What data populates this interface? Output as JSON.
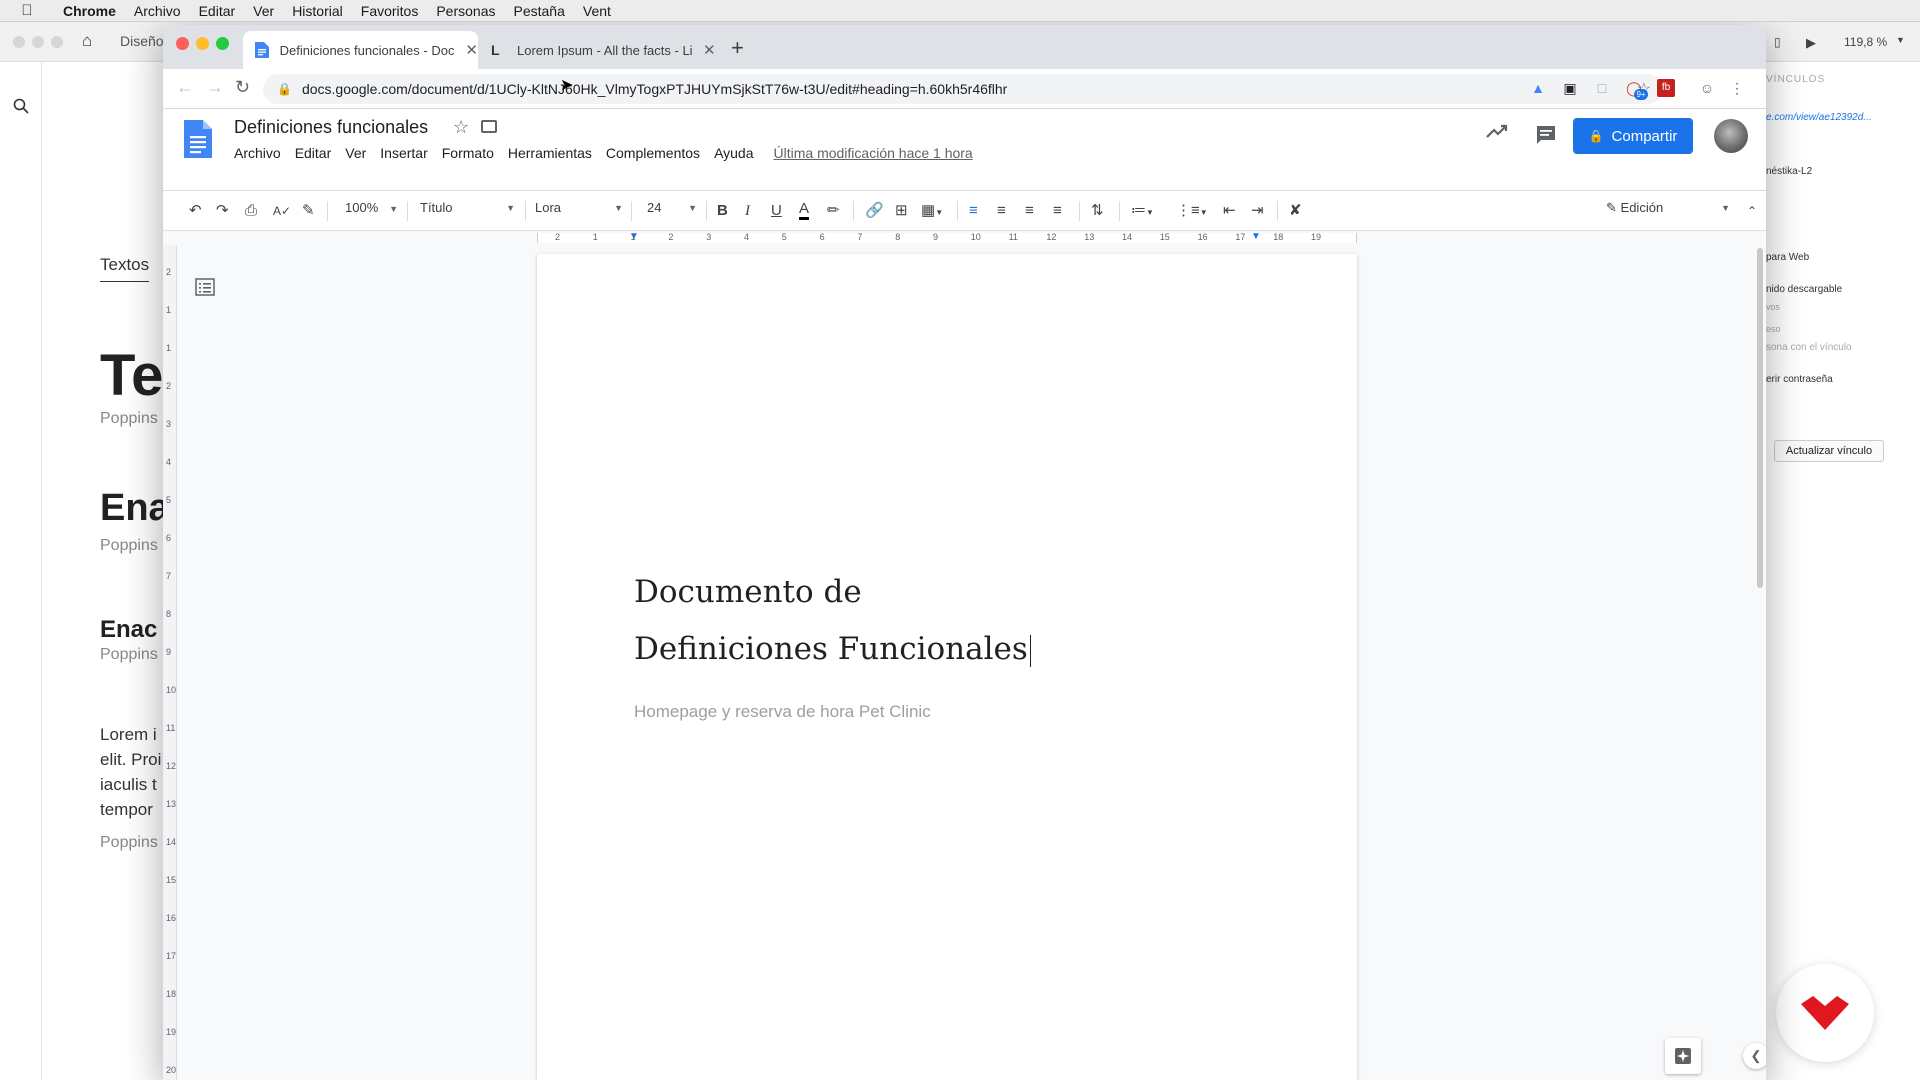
{
  "menubar": {
    "app": "Chrome",
    "items": [
      "Archivo",
      "Editar",
      "Ver",
      "Historial",
      "Favoritos",
      "Personas",
      "Pestaña",
      "Vent"
    ]
  },
  "background_app": {
    "breadcrumb": "Diseño",
    "tab_label": "Textos",
    "heading1": "Te",
    "caption1": "Poppins",
    "heading2": "Ena",
    "caption2": "Poppins",
    "heading3": "Enac",
    "caption3": "Poppins",
    "paragraph": "Lorem i\nelit. Proi\niaculis t\ntempor",
    "caption4": "Poppins",
    "zoom_status": "119,8 %",
    "right_panel": {
      "title": "VÍNCULOS",
      "link_url": "e.com/view/ae12392d...",
      "project": "néstika-L2",
      "format": "para Web",
      "downloadable": "nido descargable",
      "vos": "vos",
      "eso": "eso",
      "share_with": "sona con el vínculo",
      "password": "erir contraseña",
      "update_button": "Actualizar vínculo"
    }
  },
  "browser": {
    "tabs": [
      {
        "title": "Definiciones funcionales - Doc",
        "active": true
      },
      {
        "title": "Lorem Ipsum - All the facts - Li",
        "active": false
      }
    ],
    "new_tab": "+",
    "url": "docs.google.com/document/d/1UCly-KltNJ60Hk_VlmyTogxPTJHUYmSjkStT76w-t3U/edit#heading=h.60kh5r46flhr",
    "extension_badge": "9+"
  },
  "docs": {
    "title": "Definiciones funcionales",
    "menu": [
      "Archivo",
      "Editar",
      "Ver",
      "Insertar",
      "Formato",
      "Herramientas",
      "Complementos",
      "Ayuda"
    ],
    "last_edit": "Última modificación hace 1 hora",
    "share_label": "Compartir",
    "toolbar": {
      "zoom": "100%",
      "style": "Título",
      "font": "Lora",
      "size": "24",
      "mode": "Edición"
    },
    "ruler_numbers": [
      "2",
      "1",
      "1",
      "2",
      "3",
      "4",
      "5",
      "6",
      "7",
      "8",
      "9",
      "10",
      "11",
      "12",
      "13",
      "14",
      "15",
      "16",
      "17",
      "18",
      "19"
    ],
    "vruler_numbers": [
      "2",
      "1",
      "1",
      "2",
      "3",
      "4",
      "5",
      "6",
      "7",
      "8",
      "9",
      "10",
      "11",
      "12",
      "13",
      "14",
      "15",
      "16",
      "17",
      "18",
      "19",
      "20"
    ],
    "content": {
      "title_line1": "Documento de",
      "title_line2": "Definiciones Funcionales",
      "subtitle": "Homepage y reserva de hora Pet Clinic"
    }
  },
  "colors": {
    "share_blue": "#1a73e8",
    "brand_red": "#e0171f",
    "docs_blue": "#4285f4"
  }
}
